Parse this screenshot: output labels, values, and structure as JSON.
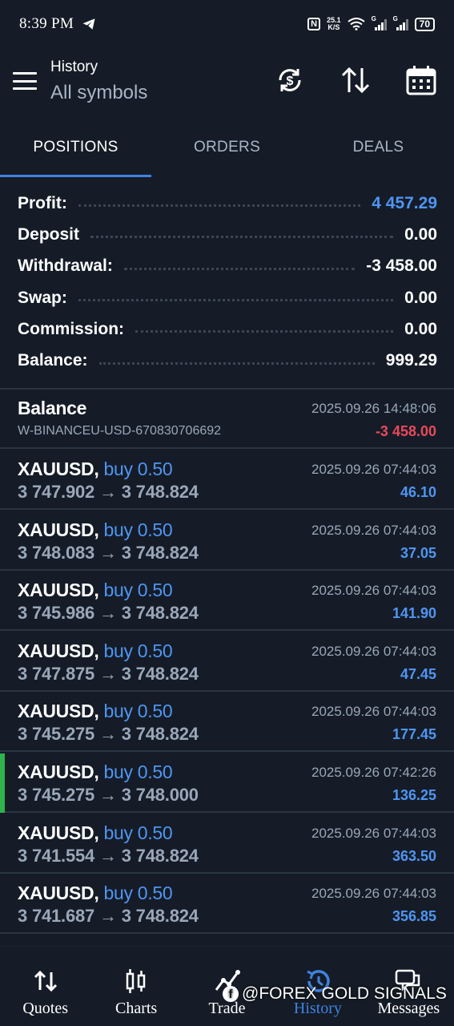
{
  "status_bar": {
    "time": "8:39 PM",
    "nfc": "N",
    "speed_value": "25.1",
    "speed_unit": "K/S",
    "sim1": "G",
    "sim2": "G",
    "battery": "70"
  },
  "header": {
    "title": "History",
    "subtitle": "All symbols"
  },
  "tabs": [
    {
      "label": "POSITIONS",
      "active": true
    },
    {
      "label": "ORDERS",
      "active": false
    },
    {
      "label": "DEALS",
      "active": false
    }
  ],
  "summary": [
    {
      "label": "Profit:",
      "value": "4 457.29"
    },
    {
      "label": "Deposit",
      "value": "0.00"
    },
    {
      "label": "Withdrawal:",
      "value": "-3 458.00"
    },
    {
      "label": "Swap:",
      "value": "0.00"
    },
    {
      "label": "Commission:",
      "value": "0.00"
    },
    {
      "label": "Balance:",
      "value": "999.29"
    }
  ],
  "balance_entry": {
    "title": "Balance",
    "comment": "W-BINANCEU-USD-670830706692",
    "time": "2025.09.26 14:48:06",
    "amount": "-3 458.00"
  },
  "deals": [
    {
      "symbol": "XAUUSD,",
      "side": "buy 0.50",
      "open": "3 747.902",
      "arrow": "→",
      "close": "3 748.824",
      "time": "2025.09.26 07:44:03",
      "profit": "46.10"
    },
    {
      "symbol": "XAUUSD,",
      "side": "buy 0.50",
      "open": "3 748.083",
      "arrow": "→",
      "close": "3 748.824",
      "time": "2025.09.26 07:44:03",
      "profit": "37.05"
    },
    {
      "symbol": "XAUUSD,",
      "side": "buy 0.50",
      "open": "3 745.986",
      "arrow": "→",
      "close": "3 748.824",
      "time": "2025.09.26 07:44:03",
      "profit": "141.90"
    },
    {
      "symbol": "XAUUSD,",
      "side": "buy 0.50",
      "open": "3 747.875",
      "arrow": "→",
      "close": "3 748.824",
      "time": "2025.09.26 07:44:03",
      "profit": "47.45"
    },
    {
      "symbol": "XAUUSD,",
      "side": "buy 0.50",
      "open": "3 745.275",
      "arrow": "→",
      "close": "3 748.824",
      "time": "2025.09.26 07:44:03",
      "profit": "177.45"
    },
    {
      "symbol": "XAUUSD,",
      "side": "buy 0.50",
      "open": "3 745.275",
      "arrow": "→",
      "close": "3 748.000",
      "time": "2025.09.26 07:42:26",
      "profit": "136.25",
      "selected": true
    },
    {
      "symbol": "XAUUSD,",
      "side": "buy 0.50",
      "open": "3 741.554",
      "arrow": "→",
      "close": "3 748.824",
      "time": "2025.09.26 07:44:03",
      "profit": "363.50"
    },
    {
      "symbol": "XAUUSD,",
      "side": "buy 0.50",
      "open": "3 741.687",
      "arrow": "→",
      "close": "3 748.824",
      "time": "2025.09.26 07:44:03",
      "profit": "356.85"
    }
  ],
  "bottom_nav": [
    {
      "label": "Quotes",
      "icon": "quotes-icon"
    },
    {
      "label": "Charts",
      "icon": "charts-icon"
    },
    {
      "label": "Trade",
      "icon": "trade-icon"
    },
    {
      "label": "History",
      "icon": "history-icon",
      "active": true
    },
    {
      "label": "Messages",
      "icon": "messages-icon"
    }
  ],
  "watermark": "@FOREX GOLD SIGNALS",
  "colors": {
    "background": "#151c27",
    "accent_blue": "#4f95f3",
    "tab_underline": "#3f82e0",
    "negative_red": "#e9495b",
    "selection_green": "#2fb34b",
    "muted_text": "#9aa7b9"
  }
}
